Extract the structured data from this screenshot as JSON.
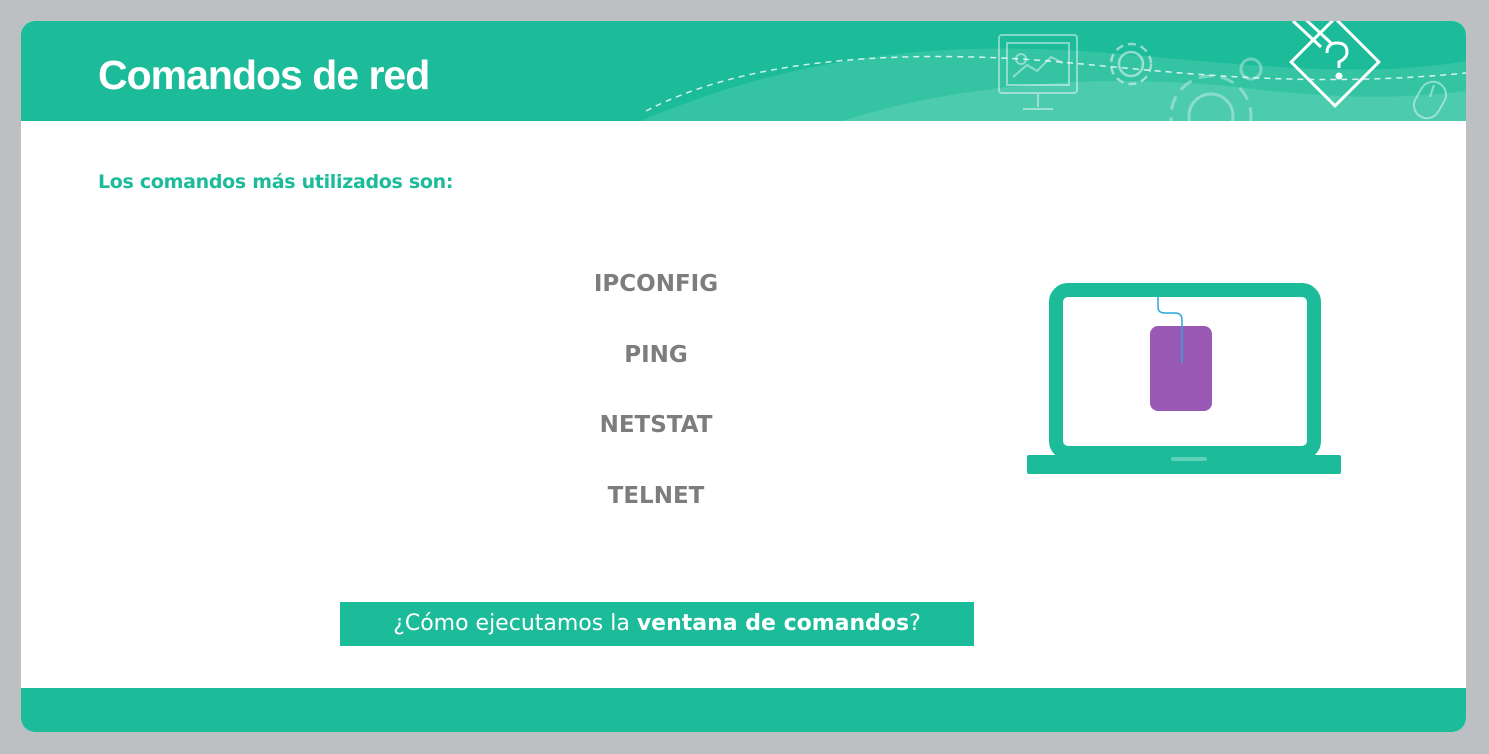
{
  "header": {
    "title": "Comandos de red"
  },
  "content": {
    "subtitle": "Los comandos más utilizados son:",
    "commands": [
      "IPCONFIG",
      "PING",
      "NETSTAT",
      "TELNET"
    ]
  },
  "cta": {
    "prefix": "¿Cómo ejecutamos la ",
    "bold": "ventana de comandos",
    "suffix": "?"
  },
  "icons": {
    "header_decor": [
      "presentation-board-icon",
      "gear-icon",
      "large-gear-icon",
      "pencil-question-icon",
      "mouse-icon"
    ],
    "illustration": "laptop-with-mouse-icon"
  },
  "colors": {
    "accent": "#1cbb99",
    "text_gray": "#7d7d7d",
    "mouse_purple": "#9b59b6",
    "background": "#bcc0c3"
  }
}
